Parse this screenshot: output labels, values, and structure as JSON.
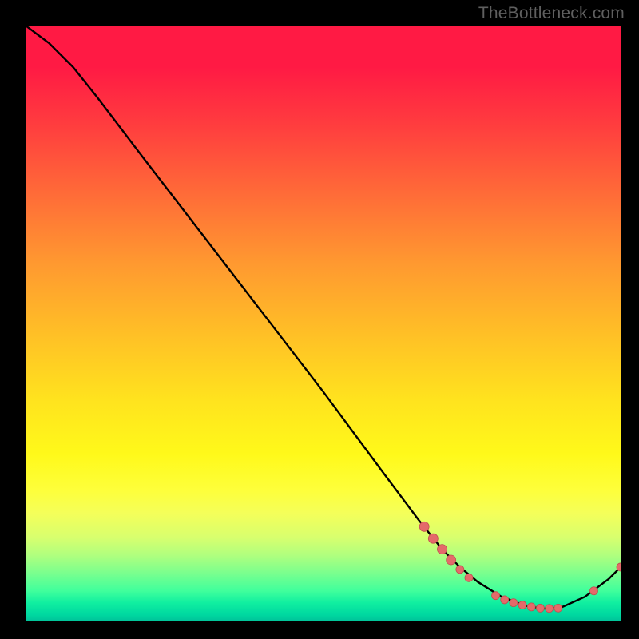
{
  "watermark": "TheBottleneck.com",
  "chart_data": {
    "type": "line",
    "title": "",
    "xlabel": "",
    "ylabel": "",
    "xlim": [
      0,
      100
    ],
    "ylim": [
      0,
      100
    ],
    "series": [
      {
        "name": "curve",
        "x": [
          0,
          4,
          8,
          12,
          20,
          30,
          40,
          50,
          60,
          66,
          70,
          73,
          76,
          80,
          84,
          87,
          90,
          94,
          98,
          100
        ],
        "y": [
          100,
          97,
          93,
          88,
          77.5,
          64.5,
          51.5,
          38.5,
          25,
          17,
          12,
          9,
          6.5,
          4,
          2.5,
          2,
          2.2,
          4,
          7,
          9
        ]
      }
    ],
    "markers": [
      {
        "x": 67.0,
        "y": 15.8,
        "r": 6
      },
      {
        "x": 68.5,
        "y": 13.8,
        "r": 6
      },
      {
        "x": 70.0,
        "y": 12.0,
        "r": 6
      },
      {
        "x": 71.5,
        "y": 10.2,
        "r": 6
      },
      {
        "x": 73.0,
        "y": 8.6,
        "r": 5
      },
      {
        "x": 74.5,
        "y": 7.2,
        "r": 5
      },
      {
        "x": 79.0,
        "y": 4.2,
        "r": 5
      },
      {
        "x": 80.5,
        "y": 3.5,
        "r": 5
      },
      {
        "x": 82.0,
        "y": 3.0,
        "r": 5
      },
      {
        "x": 83.5,
        "y": 2.6,
        "r": 5
      },
      {
        "x": 85.0,
        "y": 2.3,
        "r": 5
      },
      {
        "x": 86.5,
        "y": 2.1,
        "r": 5
      },
      {
        "x": 88.0,
        "y": 2.05,
        "r": 5
      },
      {
        "x": 89.5,
        "y": 2.1,
        "r": 5
      },
      {
        "x": 95.5,
        "y": 5.0,
        "r": 5
      },
      {
        "x": 100.0,
        "y": 9.0,
        "r": 5
      }
    ],
    "colors": {
      "curve": "#000000",
      "marker_fill": "#e46a6a",
      "marker_stroke": "#c05050"
    }
  }
}
